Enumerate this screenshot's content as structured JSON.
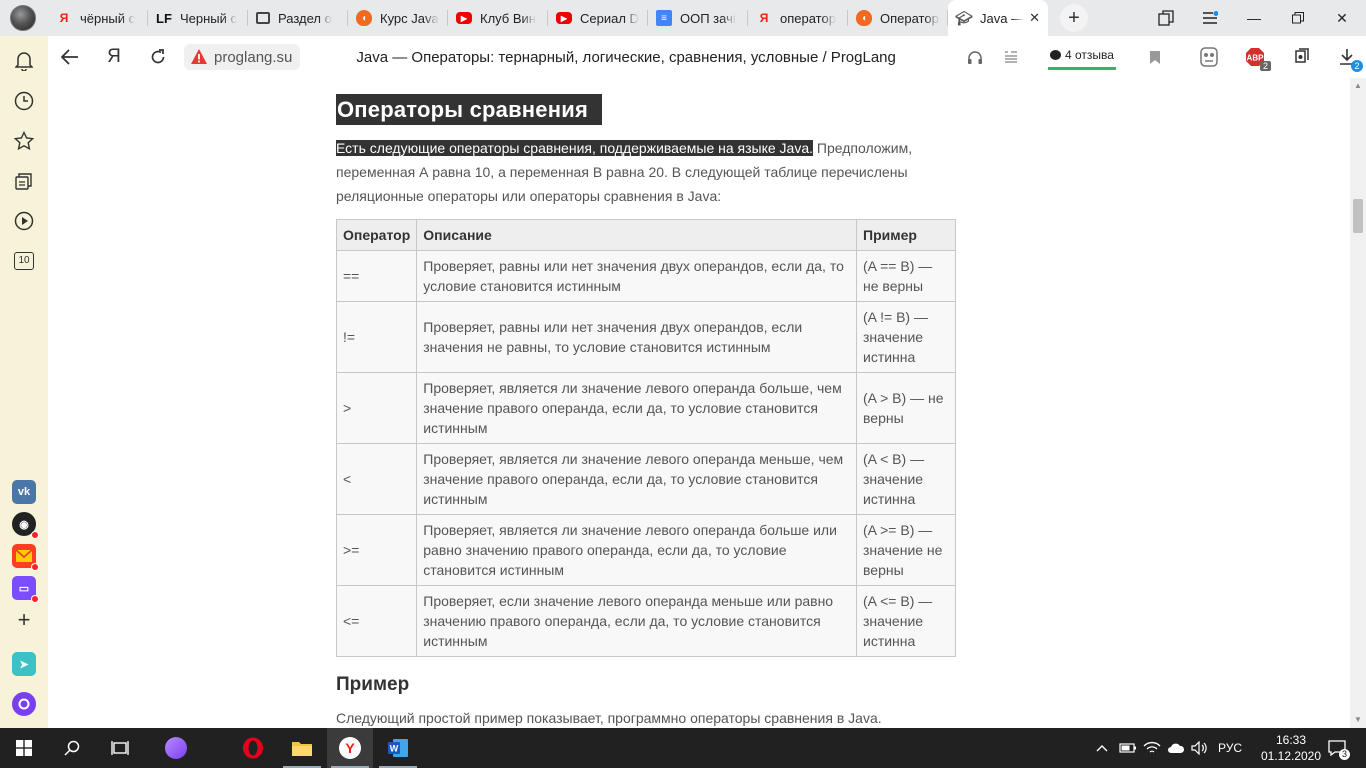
{
  "browser": {
    "tabs": [
      {
        "label": "чёрный с",
        "icon": "yandex-icon"
      },
      {
        "label": "Черный с",
        "icon": "lf-icon"
      },
      {
        "label": "Раздел о",
        "icon": "mail-icon"
      },
      {
        "label": "Курс Java",
        "icon": "shield-icon"
      },
      {
        "label": "Клуб Вин",
        "icon": "youtube-icon"
      },
      {
        "label": "Сериал D",
        "icon": "youtube-icon"
      },
      {
        "label": "ООП зачі",
        "icon": "docs-icon"
      },
      {
        "label": "оператор",
        "icon": "yandex-icon"
      },
      {
        "label": "Операторы",
        "icon": "shield-icon"
      },
      {
        "label": "Java —",
        "icon": "graduation-cap-icon"
      }
    ],
    "active_tab_index": 9,
    "address": {
      "domain": "proglang.su",
      "title": "Java — Операторы: тернарный, логические, сравнения, условные / ProgLang"
    },
    "reviews_label": "4 отзыва",
    "adblock_badge": "2",
    "downloads_badge": "2",
    "sidebar_counter": "10"
  },
  "page": {
    "section_title": "Операторы сравнения",
    "intro_highlight": "Есть следующие операторы сравнения, поддерживаемые на языке Java.",
    "intro_rest": " Предположим, переменная А равна 10, а переменная B равна 20. В следующей таблице перечислены реляционные операторы или операторы сравнения в Java:",
    "table": {
      "headers": [
        "Оператор",
        "Описание",
        "Пример"
      ],
      "rows": [
        {
          "op": "==",
          "desc": "Проверяет, равны или нет значения двух операндов, если да, то условие становится истинным",
          "example": "(A == B) — не верны"
        },
        {
          "op": "!=",
          "desc": "Проверяет, равны или нет значения двух операндов, если значения не равны, то условие становится истинным",
          "example": "(A != B) — значение истинна"
        },
        {
          "op": ">",
          "desc": "Проверяет, является ли значение левого операнда больше, чем значение правого операнда, если да, то условие становится истинным",
          "example": "(A > B) — не верны"
        },
        {
          "op": "<",
          "desc": "Проверяет, является ли значение левого операнда меньше, чем значение правого операнда, если да, то условие становится истинным",
          "example": "(A < B) — значение истинна"
        },
        {
          "op": ">=",
          "desc": "Проверяет, является ли значение левого операнда больше или равно значению правого операнда, если да, то условие становится истинным",
          "example": "(A >= B) — значение не верны"
        },
        {
          "op": "<=",
          "desc": "Проверяет, если значение левого операнда меньше или равно значению правого операнда, если да, то условие становится истинным",
          "example": "(A <= B) — значение истинна"
        }
      ]
    },
    "example_title": "Пример",
    "example_text": "Следующий простой пример показывает, программно операторы сравнения в Java."
  },
  "taskbar": {
    "language": "РУС",
    "time": "16:33",
    "date": "01.12.2020",
    "notifications_count": "3"
  },
  "colors": {
    "accent_green": "#35b36b",
    "section_bg": "#333333",
    "sidebar_bg": "#f7f3d9"
  }
}
